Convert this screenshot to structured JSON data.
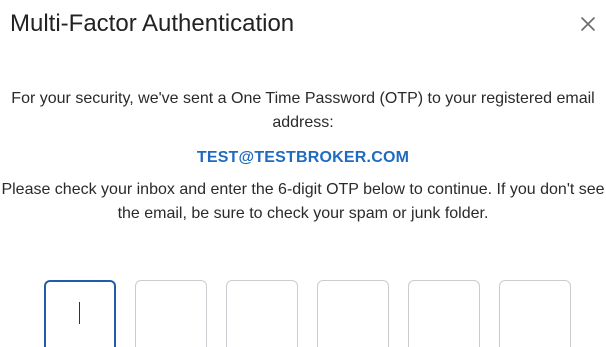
{
  "dialog": {
    "title": "Multi-Factor Authentication",
    "close_icon": "close-icon"
  },
  "message": {
    "intro": "For your security, we've sent a One Time Password (OTP) to your registered email address:",
    "email": "TEST@TESTBROKER.COM",
    "instructions": "Please check your inbox and enter the 6-digit OTP below to continue. If you don't see the email, be sure to check your spam or junk folder."
  },
  "otp": {
    "digits": [
      "",
      "",
      "",
      "",
      "",
      ""
    ],
    "active_index": 0
  },
  "colors": {
    "email": "#1f6bc0",
    "active_border": "#1f5fa8",
    "box_border": "#c9ccd1"
  }
}
